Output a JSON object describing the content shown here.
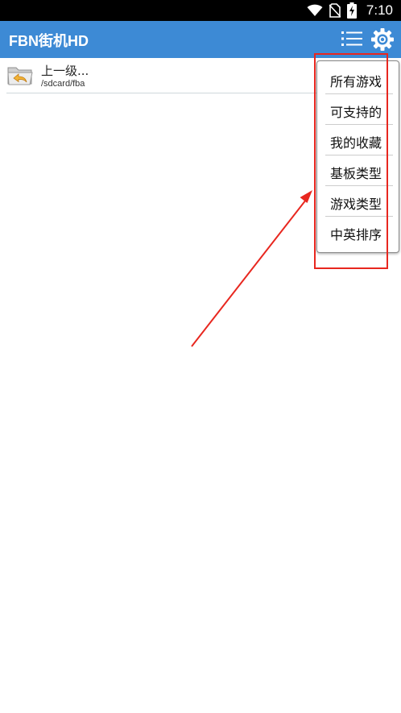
{
  "status_bar": {
    "time": "7:10",
    "icons": [
      "wifi-icon",
      "no-sim-icon",
      "battery-charging-icon"
    ]
  },
  "app_bar": {
    "title": "FBN街机HD",
    "actions": [
      "list-icon",
      "gear-icon"
    ],
    "color": "#3d8ad5"
  },
  "file_list": {
    "items": [
      {
        "name": "上一级...",
        "path": "/sdcard/fba",
        "icon": "folder-up-icon"
      }
    ]
  },
  "popup_menu": {
    "items": [
      {
        "label": "所有游戏"
      },
      {
        "label": "可支持的"
      },
      {
        "label": "我的收藏"
      },
      {
        "label": "基板类型"
      },
      {
        "label": "游戏类型"
      },
      {
        "label": "中英排序"
      }
    ]
  },
  "annotation": {
    "color": "#e8271f",
    "shapes": [
      "highlight-box",
      "arrow"
    ]
  }
}
